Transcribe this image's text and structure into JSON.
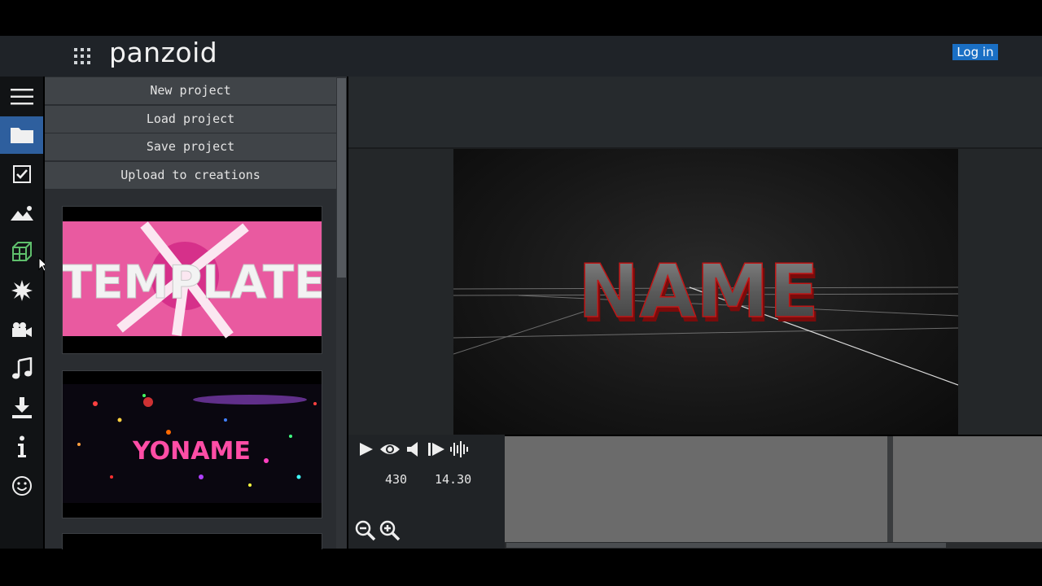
{
  "header": {
    "brand": "panzoid",
    "login_label": "Log in"
  },
  "sidebar": {
    "icons": [
      "menu-icon",
      "folder-icon",
      "checkbox-icon",
      "image-icon",
      "cube-icon",
      "starburst-icon",
      "camera-icon",
      "music-icon",
      "download-icon",
      "info-icon",
      "smiley-icon"
    ],
    "active": "folder-icon"
  },
  "file_menu": {
    "new_project": "New project",
    "load_project": "Load project",
    "save_project": "Save project",
    "upload": "Upload to creations"
  },
  "templates": [
    {
      "text": "TEMPLATE"
    },
    {
      "text": "YONAME"
    }
  ],
  "preview": {
    "text": "NAME"
  },
  "playback": {
    "frame": "430",
    "time": "14.30"
  },
  "colors": {
    "accent": "#1a6fc4",
    "active_tab": "#2e5f9e",
    "panel": "#2a2d31",
    "timeline": "#6b6b6b"
  }
}
